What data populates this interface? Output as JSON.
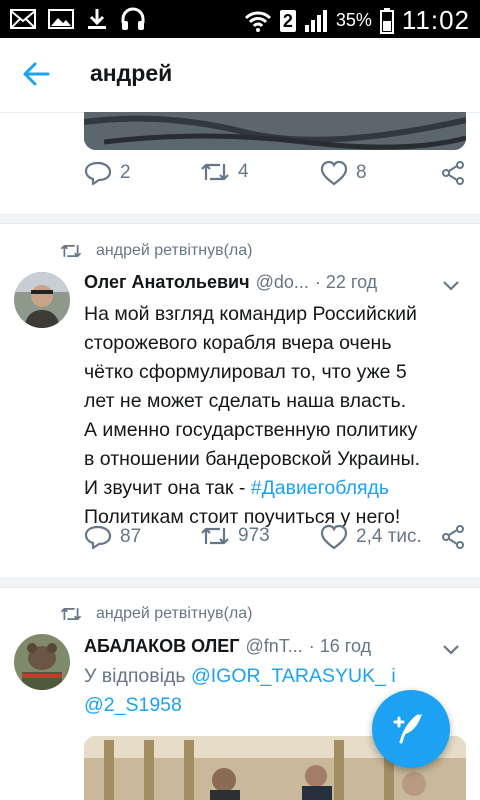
{
  "status_bar": {
    "sim_slot": "2",
    "battery": "35%",
    "time": "11:02",
    "icons": [
      "mail-icon",
      "image-icon",
      "download-icon",
      "headset-icon",
      "wifi-icon",
      "signal-icon",
      "battery-icon"
    ]
  },
  "header": {
    "title": "андрей"
  },
  "top_tweet_actions": {
    "replies": "2",
    "retweets": "4",
    "likes": "8"
  },
  "tweet1": {
    "retweet_label": "андрей ретвітнув(ла)",
    "name": "Олег Анатольевич",
    "handle": "@do...",
    "time": "· 22 год",
    "text_lines": [
      "На мой взгляд командир Российский",
      "сторожевого корабля вчера очень",
      "чётко сформулировал то, что уже 5",
      "лет не может сделать наша власть.",
      "А именно государственную политику",
      "в отношении бандеровской Украины.",
      "И звучит она так - ",
      "Политикам стоит поучиться у него!"
    ],
    "hashtag": "#Давиегоблядь",
    "replies": "87",
    "retweets": "973",
    "likes": "2,4 тис."
  },
  "tweet2": {
    "retweet_label": "андрей ретвітнув(ла)",
    "name": "АБАЛАКОВ ОЛЕГ",
    "handle": "@fnT...",
    "time": "· 16 год",
    "reply_prefix": "У відповідь ",
    "mention1": "@IGOR_TARASYUK_",
    "mention_joiner": " і",
    "mention2": "@2_S1958"
  },
  "colors": {
    "accent": "#1da1f2",
    "muted": "#657786",
    "text": "#14171a"
  },
  "fab": {
    "icon": "compose-feather-icon"
  }
}
